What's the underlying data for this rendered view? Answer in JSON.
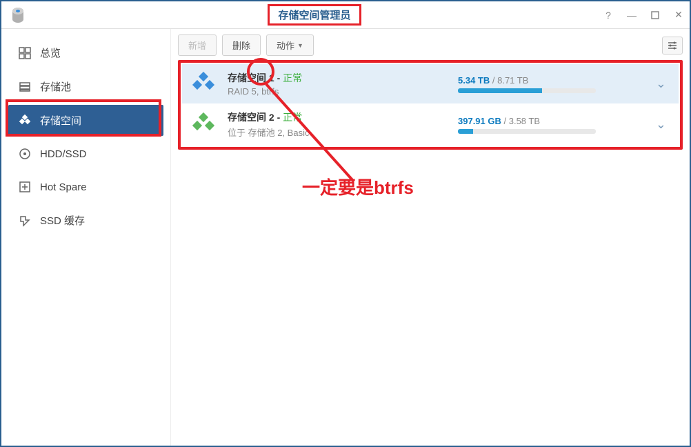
{
  "window": {
    "title": "存储空间管理员"
  },
  "sidebar": {
    "items": [
      {
        "label": "总览"
      },
      {
        "label": "存储池"
      },
      {
        "label": "存储空间"
      },
      {
        "label": "HDD/SSD"
      },
      {
        "label": "Hot Spare"
      },
      {
        "label": "SSD 缓存"
      }
    ]
  },
  "toolbar": {
    "new_label": "新增",
    "delete_label": "删除",
    "action_label": "动作"
  },
  "volumes": [
    {
      "name": "存储空间 1",
      "status": "正常",
      "sub": "RAID 5, btrfs",
      "used": "5.34 TB",
      "total": "8.71 TB",
      "pct": 61
    },
    {
      "name": "存储空间 2",
      "status": "正常",
      "sub": "位于 存储池 2, Basic",
      "used": "397.91 GB",
      "total": "3.58 TB",
      "pct": 11
    }
  ],
  "annotation": {
    "text": "一定要是btrfs"
  }
}
